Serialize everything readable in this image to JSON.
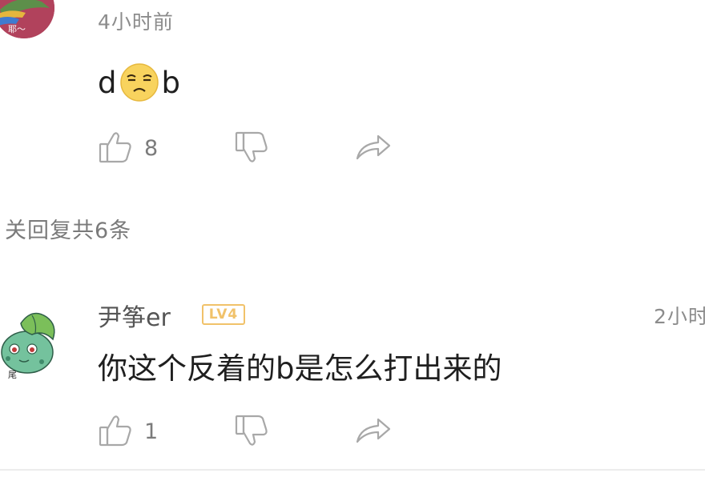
{
  "comments": [
    {
      "avatar_label": "耶～",
      "time": "4小时前",
      "content_prefix": "d",
      "content_suffix": "b",
      "content_emoji": "dazed-face-emoji",
      "likes": "8"
    },
    {
      "username": "尹筝er",
      "level_badge": "LV4",
      "avatar_label": "尾",
      "time": "2小时",
      "content": "你这个反着的b是怎么打出来的",
      "likes": "1"
    }
  ],
  "replies_summary": "关回复共6条",
  "icons": {
    "like": "thumbs-up-icon",
    "dislike": "thumbs-down-icon",
    "share": "share-arrow-icon"
  },
  "colors": {
    "icon_gray": "#a8a8a8",
    "time_gray": "#8c8c8c",
    "badge_gold": "#f1c26a",
    "emoji_yellow": "#f8d35e"
  }
}
